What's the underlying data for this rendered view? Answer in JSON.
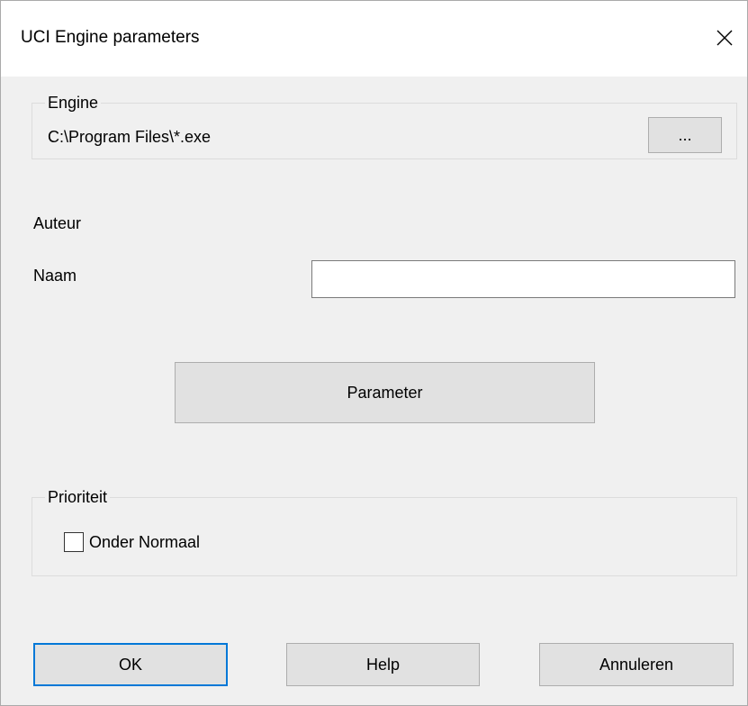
{
  "window": {
    "title": "UCI Engine parameters",
    "close_glyph": "close-icon"
  },
  "engine_group": {
    "legend": "Engine",
    "path": "C:\\Program Files\\*.exe",
    "browse_label": "..."
  },
  "author_label": "Auteur",
  "name_field": {
    "label": "Naam",
    "value": "",
    "placeholder": ""
  },
  "parameter_button": "Parameter",
  "priority_group": {
    "legend": "Prioriteit",
    "checkbox_label": "Onder Normaal",
    "checked": false
  },
  "footer": {
    "ok_label": "OK",
    "help_label": "Help",
    "cancel_label": "Annuleren"
  },
  "colors": {
    "dialog_bg": "#f0f0f0",
    "titlebar_bg": "#ffffff",
    "default_button_border": "#0078d7"
  }
}
